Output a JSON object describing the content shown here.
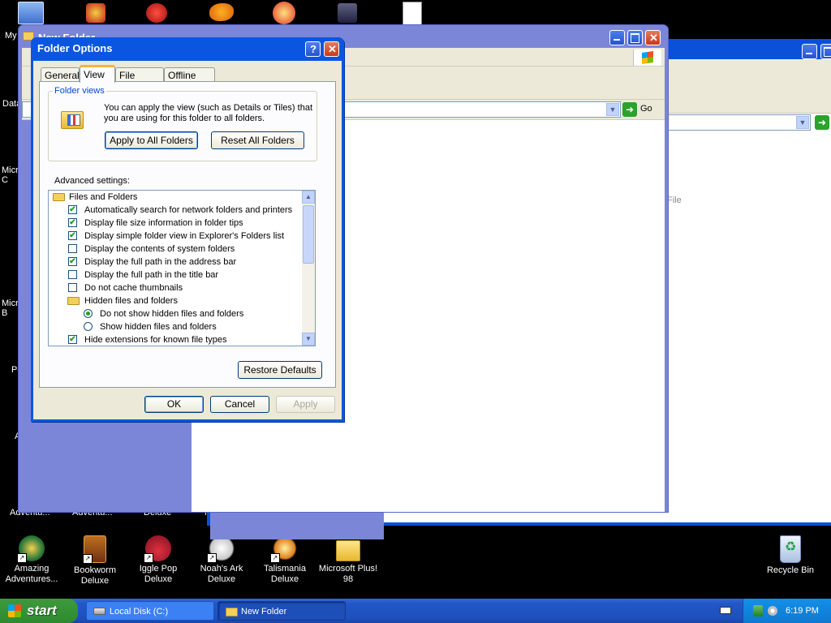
{
  "desktop": {
    "top_icons_partial": [
      "My",
      "Data",
      "Micro C",
      "Micro B",
      "Po",
      "A"
    ],
    "bottom_icons": [
      {
        "label1": "Amazing",
        "label2": "Adventures..."
      },
      {
        "label1": "Bookworm",
        "label2": "Deluxe"
      },
      {
        "label1": "Iggle Pop",
        "label2": "Deluxe"
      },
      {
        "label1": "Noah's Ark",
        "label2": "Deluxe"
      },
      {
        "label1": "Talismania",
        "label2": "Deluxe"
      },
      {
        "label1": "Microsoft Plus!",
        "label2": "98"
      }
    ],
    "partial_row_labels": [
      "Adventu...",
      "Adventu...",
      "Deluxe",
      "M"
    ],
    "recycle_bin": "Recycle Bin"
  },
  "explorer_back": {
    "title": "Local Disk (C:)",
    "address_go": "",
    "side_text": "File"
  },
  "explorer_main": {
    "title": "New Folder",
    "go_label": "Go"
  },
  "dialog": {
    "title": "Folder Options",
    "tabs": [
      "General",
      "View",
      "File Types",
      "Offline Files"
    ],
    "folder_views": {
      "legend": "Folder views",
      "description_line1": "You can apply the view (such as Details or Tiles) that",
      "description_line2": "you are using for this folder to all folders.",
      "apply_button": "Apply to All Folders",
      "reset_button": "Reset All Folders"
    },
    "advanced_label": "Advanced settings:",
    "advanced_items": [
      {
        "type": "folder",
        "label": "Files and Folders",
        "indent": 0
      },
      {
        "type": "checkbox",
        "label": "Automatically search for network folders and printers",
        "checked": "✔",
        "indent": 1
      },
      {
        "type": "checkbox",
        "label": "Display file size information in folder tips",
        "checked": "✔",
        "indent": 1
      },
      {
        "type": "checkbox",
        "label": "Display simple folder view in Explorer's Folders list",
        "checked": "✔",
        "indent": 1
      },
      {
        "type": "checkbox",
        "label": "Display the contents of system folders",
        "checked": "",
        "indent": 1
      },
      {
        "type": "checkbox",
        "label": "Display the full path in the address bar",
        "checked": "✔",
        "indent": 1
      },
      {
        "type": "checkbox",
        "label": "Display the full path in the title bar",
        "checked": "",
        "indent": 1
      },
      {
        "type": "checkbox",
        "label": "Do not cache thumbnails",
        "checked": "",
        "indent": 1
      },
      {
        "type": "folder",
        "label": "Hidden files and folders",
        "indent": 1
      },
      {
        "type": "radio",
        "label": "Do not show hidden files and folders",
        "on": true,
        "indent": 2
      },
      {
        "type": "radio",
        "label": "Show hidden files and folders",
        "on": false,
        "indent": 2
      },
      {
        "type": "checkbox",
        "label": "Hide extensions for known file types",
        "checked": "✔",
        "indent": 1
      }
    ],
    "restore_button": "Restore Defaults",
    "ok_button": "OK",
    "cancel_button": "Cancel",
    "apply_button": "Apply"
  },
  "taskbar": {
    "start_label": "start",
    "tasks": [
      "Local Disk (C:)",
      "New Folder"
    ],
    "clock": "6:19 PM"
  },
  "colors": {
    "titlebar_blue": "#0a56e0",
    "dialog_face": "#ece9d8",
    "check_green": "#21a121",
    "start_green": "#3c9a3c"
  }
}
